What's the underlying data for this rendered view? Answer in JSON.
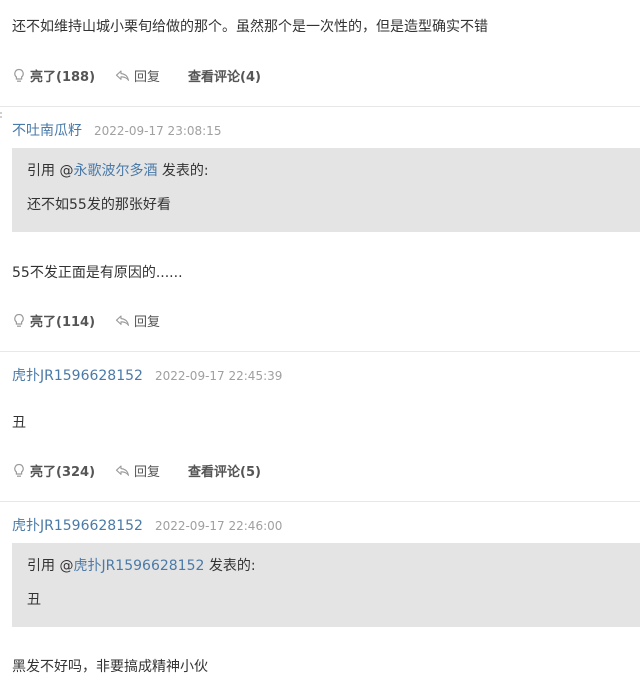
{
  "top_comment": {
    "content": "还不如维持山城小栗旬给做的那个。虽然那个是一次性的，但是造型确实不错",
    "likes_label": "亮了(188)",
    "reply_label": "回复",
    "comments_label": "查看评论(4)"
  },
  "posts": [
    {
      "username": "不吐南瓜籽",
      "time": "2022-09-17 23:08:15",
      "quote": {
        "prefix": "引用 @",
        "name": "永歌波尔多酒",
        "suffix": " 发表的:",
        "text": "还不如55发的那张好看"
      },
      "content": "55不发正面是有原因的......",
      "likes_label": "亮了(114)",
      "reply_label": "回复"
    },
    {
      "username": "虎扑JR1596628152",
      "time": "2022-09-17 22:45:39",
      "content": "丑",
      "likes_label": "亮了(324)",
      "reply_label": "回复",
      "comments_label": "查看评论(5)"
    },
    {
      "username": "虎扑JR1596628152",
      "time": "2022-09-17 22:46:00",
      "quote": {
        "prefix": "引用 @",
        "name": "虎扑JR1596628152",
        "suffix": " 发表的:",
        "text": "丑"
      },
      "content": "黑发不好吗，非要搞成精神小伙"
    }
  ],
  "icons": {
    "like": "lightbulb-icon",
    "reply": "reply-arrow-icon"
  },
  "colors": {
    "username": "#4a7aa8",
    "quote_bg": "#e4e4e4",
    "timestamp": "#a0a0a0",
    "divider": "#e8e8e8"
  }
}
